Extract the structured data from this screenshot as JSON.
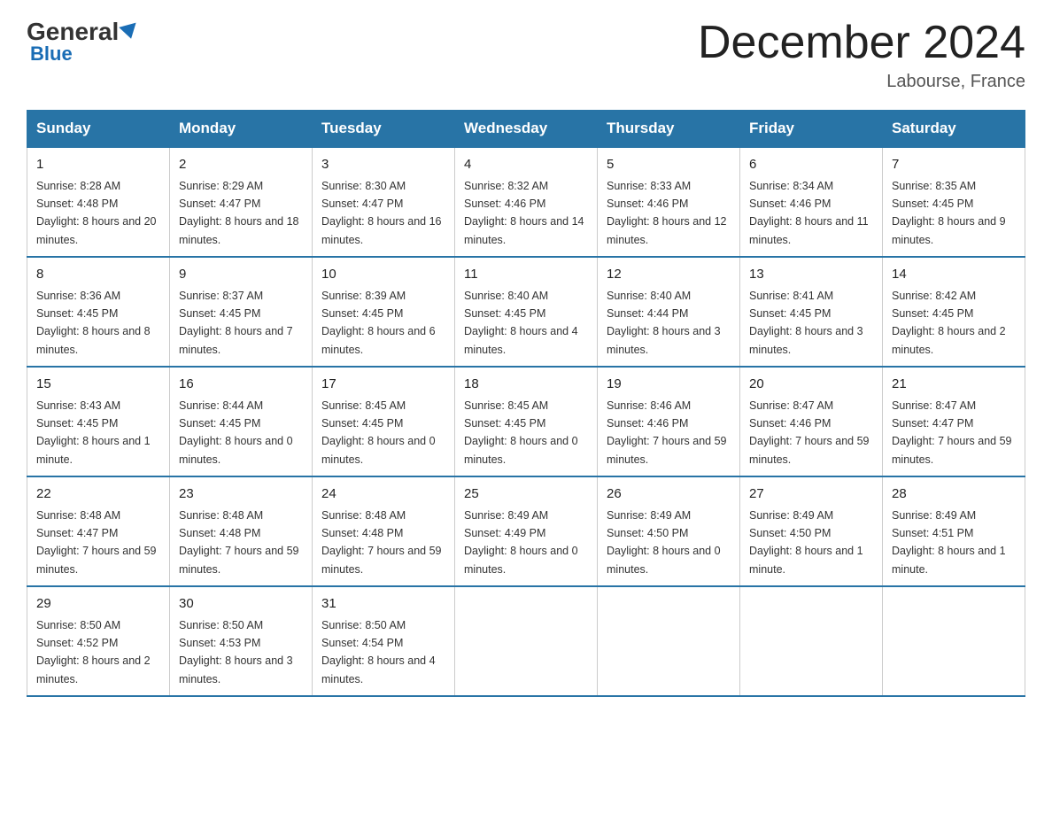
{
  "header": {
    "logo_general": "General",
    "logo_blue": "Blue",
    "month_title": "December 2024",
    "location": "Labourse, France"
  },
  "weekdays": [
    "Sunday",
    "Monday",
    "Tuesday",
    "Wednesday",
    "Thursday",
    "Friday",
    "Saturday"
  ],
  "weeks": [
    [
      {
        "day": "1",
        "sunrise": "8:28 AM",
        "sunset": "4:48 PM",
        "daylight": "8 hours and 20 minutes."
      },
      {
        "day": "2",
        "sunrise": "8:29 AM",
        "sunset": "4:47 PM",
        "daylight": "8 hours and 18 minutes."
      },
      {
        "day": "3",
        "sunrise": "8:30 AM",
        "sunset": "4:47 PM",
        "daylight": "8 hours and 16 minutes."
      },
      {
        "day": "4",
        "sunrise": "8:32 AM",
        "sunset": "4:46 PM",
        "daylight": "8 hours and 14 minutes."
      },
      {
        "day": "5",
        "sunrise": "8:33 AM",
        "sunset": "4:46 PM",
        "daylight": "8 hours and 12 minutes."
      },
      {
        "day": "6",
        "sunrise": "8:34 AM",
        "sunset": "4:46 PM",
        "daylight": "8 hours and 11 minutes."
      },
      {
        "day": "7",
        "sunrise": "8:35 AM",
        "sunset": "4:45 PM",
        "daylight": "8 hours and 9 minutes."
      }
    ],
    [
      {
        "day": "8",
        "sunrise": "8:36 AM",
        "sunset": "4:45 PM",
        "daylight": "8 hours and 8 minutes."
      },
      {
        "day": "9",
        "sunrise": "8:37 AM",
        "sunset": "4:45 PM",
        "daylight": "8 hours and 7 minutes."
      },
      {
        "day": "10",
        "sunrise": "8:39 AM",
        "sunset": "4:45 PM",
        "daylight": "8 hours and 6 minutes."
      },
      {
        "day": "11",
        "sunrise": "8:40 AM",
        "sunset": "4:45 PM",
        "daylight": "8 hours and 4 minutes."
      },
      {
        "day": "12",
        "sunrise": "8:40 AM",
        "sunset": "4:44 PM",
        "daylight": "8 hours and 3 minutes."
      },
      {
        "day": "13",
        "sunrise": "8:41 AM",
        "sunset": "4:45 PM",
        "daylight": "8 hours and 3 minutes."
      },
      {
        "day": "14",
        "sunrise": "8:42 AM",
        "sunset": "4:45 PM",
        "daylight": "8 hours and 2 minutes."
      }
    ],
    [
      {
        "day": "15",
        "sunrise": "8:43 AM",
        "sunset": "4:45 PM",
        "daylight": "8 hours and 1 minute."
      },
      {
        "day": "16",
        "sunrise": "8:44 AM",
        "sunset": "4:45 PM",
        "daylight": "8 hours and 0 minutes."
      },
      {
        "day": "17",
        "sunrise": "8:45 AM",
        "sunset": "4:45 PM",
        "daylight": "8 hours and 0 minutes."
      },
      {
        "day": "18",
        "sunrise": "8:45 AM",
        "sunset": "4:45 PM",
        "daylight": "8 hours and 0 minutes."
      },
      {
        "day": "19",
        "sunrise": "8:46 AM",
        "sunset": "4:46 PM",
        "daylight": "7 hours and 59 minutes."
      },
      {
        "day": "20",
        "sunrise": "8:47 AM",
        "sunset": "4:46 PM",
        "daylight": "7 hours and 59 minutes."
      },
      {
        "day": "21",
        "sunrise": "8:47 AM",
        "sunset": "4:47 PM",
        "daylight": "7 hours and 59 minutes."
      }
    ],
    [
      {
        "day": "22",
        "sunrise": "8:48 AM",
        "sunset": "4:47 PM",
        "daylight": "7 hours and 59 minutes."
      },
      {
        "day": "23",
        "sunrise": "8:48 AM",
        "sunset": "4:48 PM",
        "daylight": "7 hours and 59 minutes."
      },
      {
        "day": "24",
        "sunrise": "8:48 AM",
        "sunset": "4:48 PM",
        "daylight": "7 hours and 59 minutes."
      },
      {
        "day": "25",
        "sunrise": "8:49 AM",
        "sunset": "4:49 PM",
        "daylight": "8 hours and 0 minutes."
      },
      {
        "day": "26",
        "sunrise": "8:49 AM",
        "sunset": "4:50 PM",
        "daylight": "8 hours and 0 minutes."
      },
      {
        "day": "27",
        "sunrise": "8:49 AM",
        "sunset": "4:50 PM",
        "daylight": "8 hours and 1 minute."
      },
      {
        "day": "28",
        "sunrise": "8:49 AM",
        "sunset": "4:51 PM",
        "daylight": "8 hours and 1 minute."
      }
    ],
    [
      {
        "day": "29",
        "sunrise": "8:50 AM",
        "sunset": "4:52 PM",
        "daylight": "8 hours and 2 minutes."
      },
      {
        "day": "30",
        "sunrise": "8:50 AM",
        "sunset": "4:53 PM",
        "daylight": "8 hours and 3 minutes."
      },
      {
        "day": "31",
        "sunrise": "8:50 AM",
        "sunset": "4:54 PM",
        "daylight": "8 hours and 4 minutes."
      },
      null,
      null,
      null,
      null
    ]
  ]
}
